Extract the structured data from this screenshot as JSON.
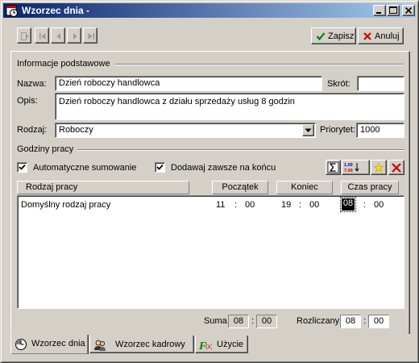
{
  "window": {
    "title": "Wzorzec dnia -"
  },
  "toolbar": {
    "save_label": "Zapisz",
    "cancel_label": "Anuluj"
  },
  "basic_info": {
    "section_title": "Informacje podstawowe",
    "name_label": "Nazwa:",
    "name_value": "Dzień roboczy handlowca",
    "short_label": "Skrót:",
    "short_value": "",
    "desc_label": "Opis:",
    "desc_value": "Dzień roboczy handlowca z działu sprzedaży usług 8 godzin",
    "type_label": "Rodzaj:",
    "type_value": "Roboczy",
    "priority_label": "Priorytet:",
    "priority_value": "1000"
  },
  "work_hours": {
    "section_title": "Godziny pracy",
    "auto_sum_label": "Automatyczne sumowanie",
    "auto_sum_checked": true,
    "append_end_label": "Dodawaj zawsze na końcu",
    "append_end_checked": true,
    "columns": {
      "type": "Rodzaj pracy",
      "start": "Początek",
      "end": "Koniec",
      "duration": "Czas pracy"
    },
    "rows": [
      {
        "type": "Domyślny rodzaj pracy",
        "start_h": "11",
        "start_m": "00",
        "end_h": "19",
        "end_m": "00",
        "dur_h": "08",
        "dur_m": "00"
      }
    ],
    "time_sep": ":"
  },
  "footer": {
    "sum_label": "Suma",
    "sum_h": "08",
    "sum_m": "00",
    "billed_label": "Rozliczany",
    "billed_h": "08",
    "billed_m": "00"
  },
  "tabs": [
    {
      "label": "Wzorzec dnia",
      "icon": "clock-icon",
      "active": true
    },
    {
      "label": "Wzorzec kadrowy",
      "icon": "people-icon",
      "active": false
    },
    {
      "label": "Użycie",
      "icon": "function-icon",
      "active": false
    }
  ],
  "colors": {
    "titlebar_start": "#0a246a",
    "titlebar_end": "#a6caf0",
    "face": "#d4d0c8",
    "save_check": "#008000",
    "cancel_x": "#cc0000"
  }
}
